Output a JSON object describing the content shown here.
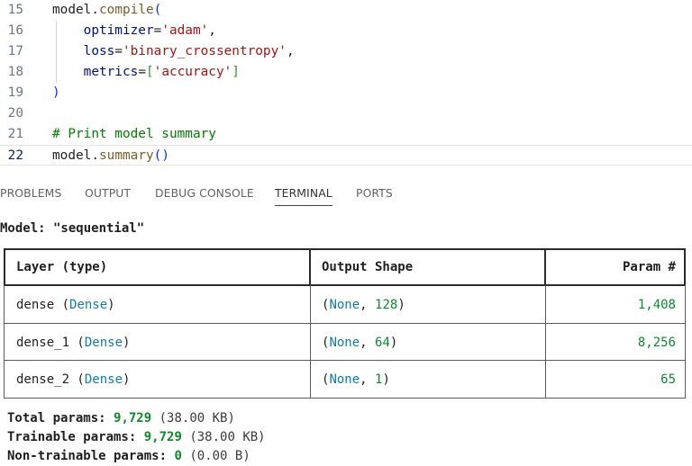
{
  "editor": {
    "lines": [
      {
        "num": "15",
        "parts": [
          [
            "plain",
            "model"
          ],
          [
            "plain",
            "."
          ],
          [
            "fn",
            "compile"
          ],
          [
            "br1",
            "("
          ]
        ]
      },
      {
        "num": "16",
        "parts": [
          [
            "plain",
            "    "
          ],
          [
            "kw-blue",
            "optimizer"
          ],
          [
            "plain",
            "="
          ],
          [
            "str",
            "'adam'"
          ],
          [
            "plain",
            ","
          ]
        ]
      },
      {
        "num": "17",
        "parts": [
          [
            "plain",
            "    "
          ],
          [
            "kw-blue",
            "loss"
          ],
          [
            "plain",
            "="
          ],
          [
            "str",
            "'binary_crossentropy'"
          ],
          [
            "plain",
            ","
          ]
        ]
      },
      {
        "num": "18",
        "parts": [
          [
            "plain",
            "    "
          ],
          [
            "kw-blue",
            "metrics"
          ],
          [
            "plain",
            "="
          ],
          [
            "br2",
            "["
          ],
          [
            "str",
            "'accuracy'"
          ],
          [
            "br2",
            "]"
          ]
        ]
      },
      {
        "num": "19",
        "parts": [
          [
            "br1",
            ")"
          ]
        ]
      },
      {
        "num": "20",
        "parts": []
      },
      {
        "num": "21",
        "parts": [
          [
            "com",
            "# Print model summary"
          ]
        ]
      },
      {
        "num": "22",
        "parts": [
          [
            "plain",
            "model"
          ],
          [
            "plain",
            "."
          ],
          [
            "fn",
            "summary"
          ],
          [
            "br1",
            "()"
          ]
        ]
      }
    ]
  },
  "panel": {
    "tabs": [
      "PROBLEMS",
      "OUTPUT",
      "DEBUG CONSOLE",
      "TERMINAL",
      "PORTS"
    ],
    "active_tab": "TERMINAL"
  },
  "terminal": {
    "model_title": "Model: \"sequential\"",
    "headers": {
      "layer": "Layer (type)",
      "shape": "Output Shape",
      "params": "Param #"
    },
    "rows": [
      {
        "name": "dense",
        "type": "Dense",
        "shape_none": "None",
        "shape_dim": "128",
        "params": "1,408"
      },
      {
        "name": "dense_1",
        "type": "Dense",
        "shape_none": "None",
        "shape_dim": "64",
        "params": "8,256"
      },
      {
        "name": "dense_2",
        "type": "Dense",
        "shape_none": "None",
        "shape_dim": "1",
        "params": "65"
      }
    ],
    "summary": [
      {
        "label": "Total params:",
        "value": "9,729",
        "extra": "(38.00 KB)"
      },
      {
        "label": "Trainable params:",
        "value": "9,729",
        "extra": "(38.00 KB)"
      },
      {
        "label": "Non-trainable params:",
        "value": "0",
        "extra": "(0.00 B)"
      }
    ]
  }
}
